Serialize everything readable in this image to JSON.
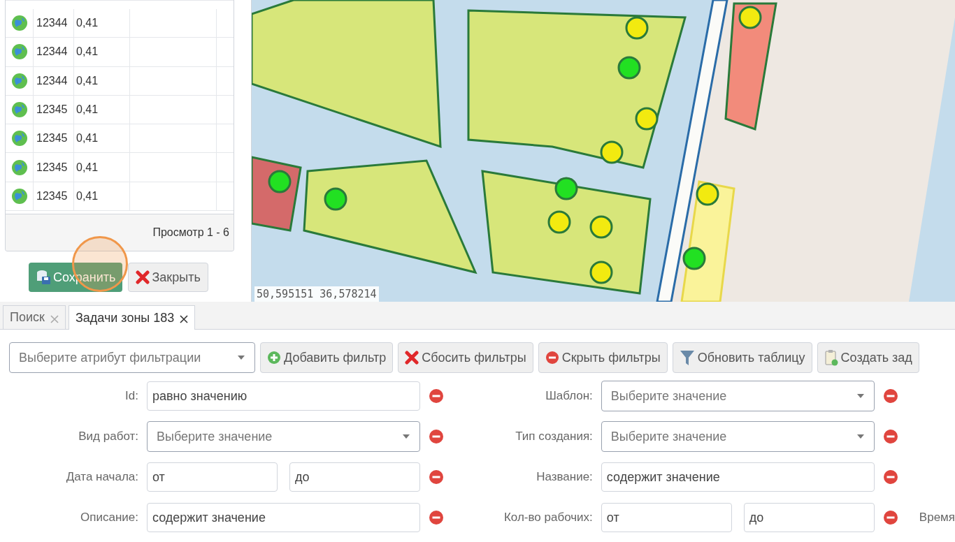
{
  "grid": {
    "rows": [
      {
        "id": "12344",
        "value": "0,41"
      },
      {
        "id": "12344",
        "value": "0,41"
      },
      {
        "id": "12344",
        "value": "0,41"
      },
      {
        "id": "12345",
        "value": "0,41"
      },
      {
        "id": "12345",
        "value": "0,41"
      },
      {
        "id": "12345",
        "value": "0,41"
      },
      {
        "id": "12345",
        "value": "0,41"
      }
    ],
    "pager": "Просмотр 1 - 6"
  },
  "dialog_buttons": [
    {
      "label": "Сохранить",
      "kind": "save"
    },
    {
      "label": "Закрыть",
      "kind": "close"
    }
  ],
  "map": {
    "coordinates": "50,595151 36,578214"
  },
  "tabs": [
    {
      "label": "Поиск",
      "selected": false
    },
    {
      "label": "Задачи зоны 183",
      "selected": true
    }
  ],
  "toolbar": {
    "attribute_select": {
      "placeholder": "Выберите атрибут фильтрации"
    },
    "buttons": [
      {
        "label": "Добавить фильтр",
        "kind": "add"
      },
      {
        "label": "Сбосить фильтры",
        "kind": "reset"
      },
      {
        "label": "Скрыть фильтры",
        "kind": "hide"
      },
      {
        "label": "Обновить таблицу",
        "kind": "refresh"
      },
      {
        "label": "Создать зад",
        "kind": "create"
      }
    ]
  },
  "filters_left": [
    {
      "label": "Id:",
      "kind": "text",
      "placeholder": "равно значению"
    },
    {
      "label": "Вид работ:",
      "kind": "select",
      "placeholder": "Выберите значение"
    },
    {
      "label": "Дата начала:",
      "kind": "range",
      "placeholder_from": "от",
      "placeholder_to": "до"
    },
    {
      "label": "Описание:",
      "kind": "text",
      "placeholder": "содержит значение"
    }
  ],
  "filters_right": [
    {
      "label": "Шаблон:",
      "kind": "select",
      "placeholder": "Выберите значение"
    },
    {
      "label": "Тип создания:",
      "kind": "select",
      "placeholder": "Выберите значение"
    },
    {
      "label": "Название:",
      "kind": "text",
      "placeholder": "содержит значение"
    },
    {
      "label": "Кол-во рабочих:",
      "kind": "range",
      "placeholder_from": "от",
      "placeholder_to": "до"
    }
  ],
  "next_filter_label": "Время"
}
